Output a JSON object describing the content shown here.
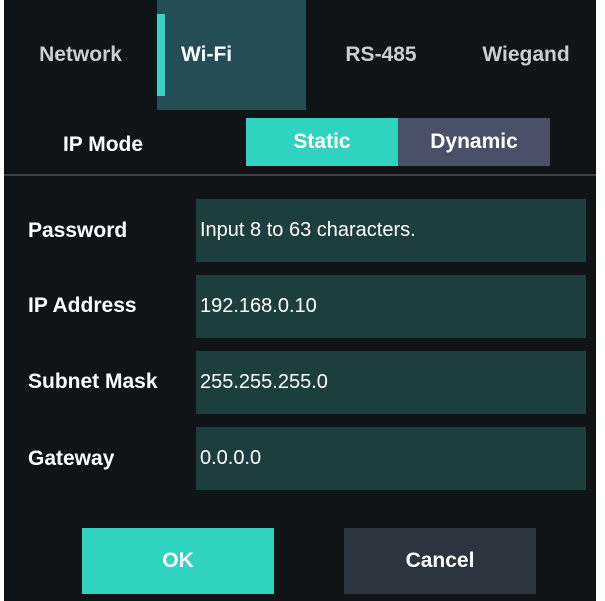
{
  "tabs": [
    {
      "label": "Network"
    },
    {
      "label": "Wi-Fi"
    },
    {
      "label": "RS-485"
    },
    {
      "label": "Wiegand"
    }
  ],
  "active_tab": "Wi-Fi",
  "ip_mode": {
    "label": "IP Mode",
    "options": [
      "Static",
      "Dynamic"
    ],
    "selected": "Static"
  },
  "fields": {
    "password": {
      "label": "Password",
      "placeholder": "Input 8 to 63 characters."
    },
    "ip_address": {
      "label": "IP Address",
      "value": "192.168.0.10"
    },
    "subnet_mask": {
      "label": "Subnet Mask",
      "value": "255.255.255.0"
    },
    "gateway": {
      "label": "Gateway",
      "value": "0.0.0.0"
    }
  },
  "buttons": {
    "ok": "OK",
    "cancel": "Cancel"
  },
  "colors": {
    "background": "#101417",
    "accent": "#2fd3c0",
    "active_tab": "#244d55",
    "field": "#1d3e3e",
    "dynamic_button": "#4a5068",
    "cancel_button": "#2c3440"
  }
}
